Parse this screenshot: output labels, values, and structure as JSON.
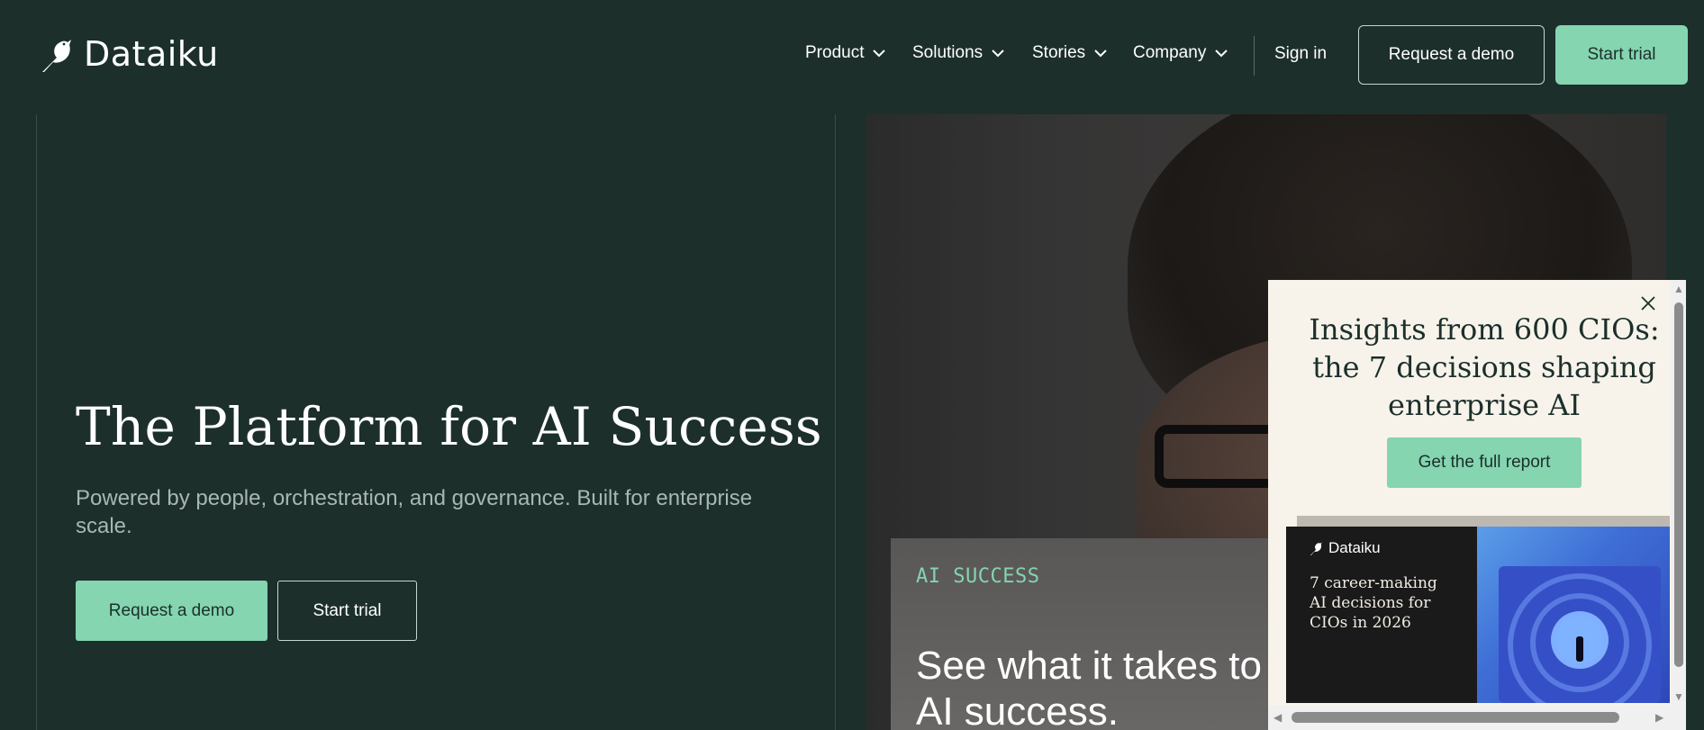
{
  "brand": {
    "name": "Dataiku"
  },
  "nav": {
    "items": [
      {
        "label": "Product"
      },
      {
        "label": "Solutions"
      },
      {
        "label": "Stories"
      },
      {
        "label": "Company"
      }
    ],
    "sign_in": "Sign in",
    "request_demo": "Request a demo",
    "start_trial": "Start trial"
  },
  "hero": {
    "title": "The Platform for AI Success",
    "subtitle": "Powered by people, orchestration, and governance. Built for enterprise scale.",
    "request_demo": "Request a demo",
    "start_trial": "Start trial"
  },
  "feature": {
    "tag": "AI SUCCESS",
    "title": "See what it takes to to AI success."
  },
  "popup": {
    "title": "Insights from 600 CIOs: the 7 decisions shaping enterprise AI",
    "cta": "Get the full report",
    "card_brand": "Dataiku",
    "card_text": "7 career-making AI decisions for CIOs in 2026"
  },
  "colors": {
    "background": "#1c2f2b",
    "accent": "#84d5b0",
    "popup_bg": "#f7f3ea"
  }
}
